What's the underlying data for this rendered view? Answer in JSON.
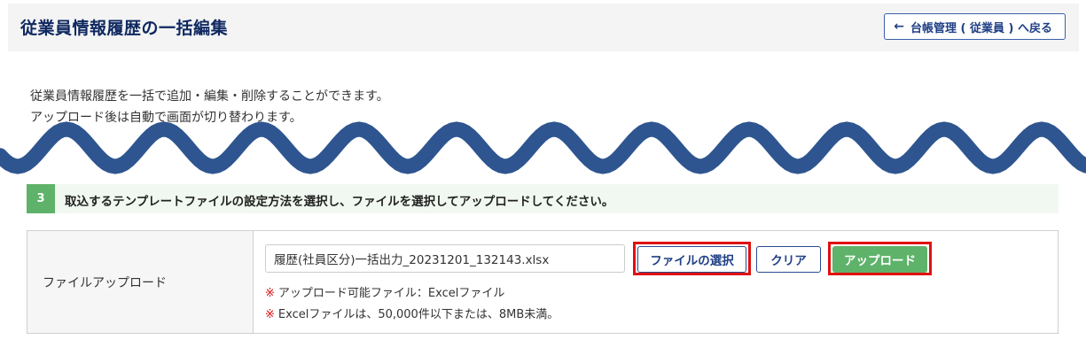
{
  "header": {
    "title": "従業員情報履歴の一括編集",
    "back_icon": "←",
    "back_label": "台帳管理 ( 従業員 ) へ戻る"
  },
  "description": {
    "line1": "従業員情報履歴を一括で追加・編集・削除することができます。",
    "line2": "アップロード後は自動で画面が切り替わります。"
  },
  "step": {
    "number": "3",
    "text": "取込するテンプレートファイルの設定方法を選択し、ファイルを選択してアップロードしてください。"
  },
  "upload": {
    "label": "ファイルアップロード",
    "file_value": "履歴(社員区分)一括出力_20231201_132143.xlsx",
    "choose_label": "ファイルの選択",
    "clear_label": "クリア",
    "upload_label": "アップロード",
    "note_mark": "※",
    "note1": "アップロード可能ファイル：Excelファイル",
    "note2": "Excelファイルは、50,000件以下または、8MB未満。"
  },
  "colors": {
    "title": "#0f2860",
    "wave": "#2e5590",
    "step_green": "#5fb26a",
    "highlight_red": "#e01010"
  }
}
